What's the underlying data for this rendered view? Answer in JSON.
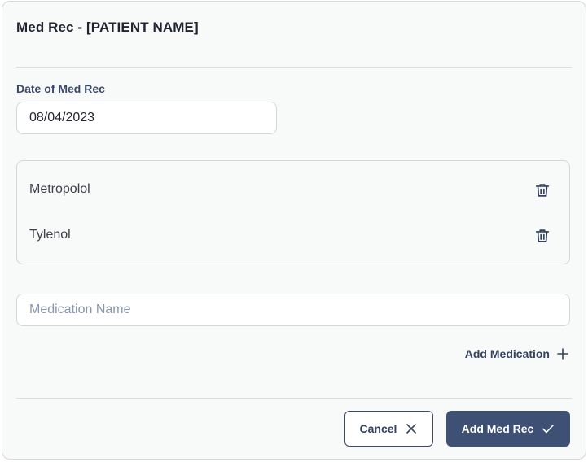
{
  "dialog": {
    "title": "Med Rec - [PATIENT NAME]"
  },
  "date_field": {
    "label": "Date of Med Rec",
    "value": "08/04/2023"
  },
  "medications": [
    {
      "name": "Metropolol",
      "delete_icon": "trash-icon"
    },
    {
      "name": "Tylenol",
      "delete_icon": "trash-icon"
    }
  ],
  "new_medication": {
    "value": "",
    "placeholder": "Medication Name"
  },
  "add_medication": {
    "label": "Add Medication",
    "icon": "plus-icon"
  },
  "footer": {
    "cancel_label": "Cancel",
    "cancel_icon": "close-icon",
    "submit_label": "Add Med Rec",
    "submit_icon": "check-icon"
  },
  "colors": {
    "primary": "#3e5074",
    "label": "#3a4a66",
    "border": "#d3d7db",
    "background": "#f8f9f9"
  }
}
